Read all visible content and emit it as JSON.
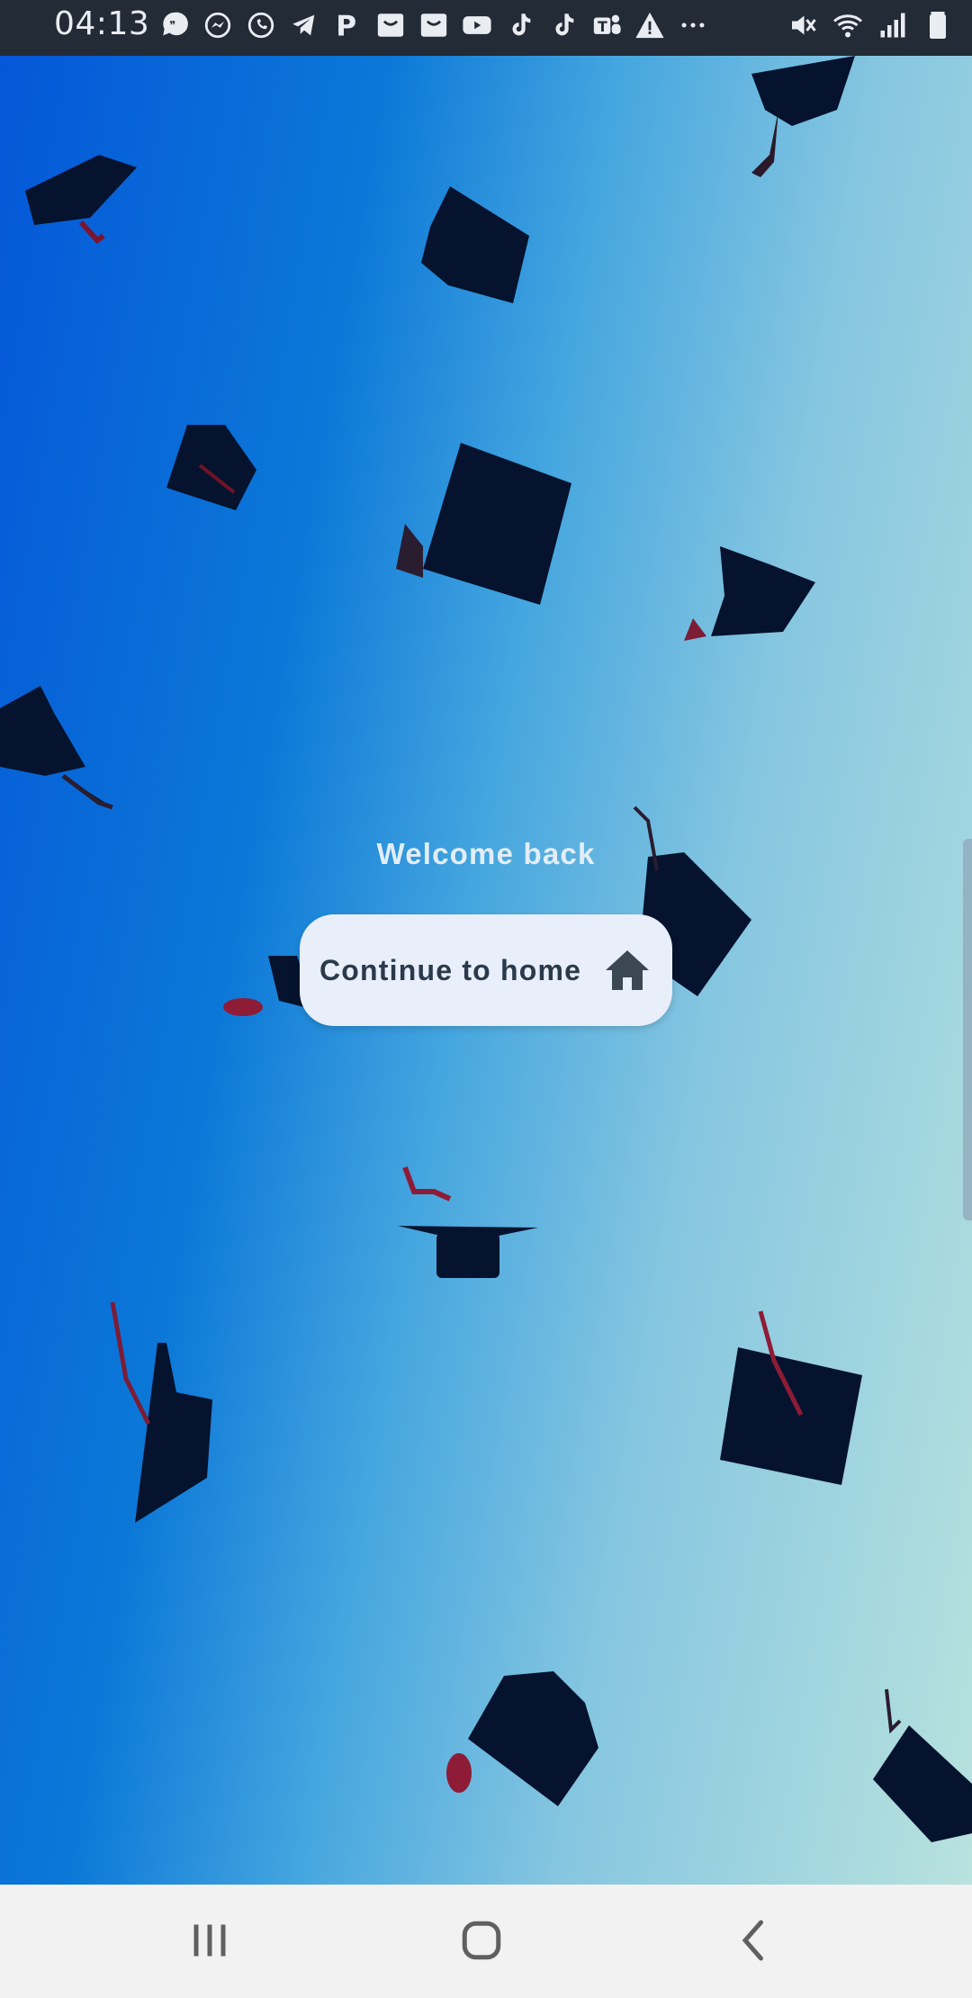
{
  "status_bar": {
    "time": "04:13",
    "notification_icons": [
      "chat-bubble-icon",
      "messenger-icon",
      "whatsapp-icon",
      "telegram-icon",
      "p-app-icon",
      "smile-box-icon",
      "smile-box-icon",
      "youtube-icon",
      "tiktok-icon",
      "tiktok-icon",
      "teams-icon",
      "warning-icon",
      "more-dots-icon"
    ],
    "system_icons": [
      "mute-icon",
      "wifi-icon",
      "signal-icon",
      "battery-icon"
    ]
  },
  "main": {
    "welcome": "Welcome back",
    "continue_label": "Continue to home",
    "continue_icon": "home-icon",
    "accent": "#e8eefa",
    "background_colors": [
      "#0557d8",
      "#45a6df",
      "#b8e2de"
    ]
  },
  "nav_bar": {
    "buttons": [
      "recent-apps-icon",
      "home-circle-icon",
      "back-icon"
    ]
  }
}
